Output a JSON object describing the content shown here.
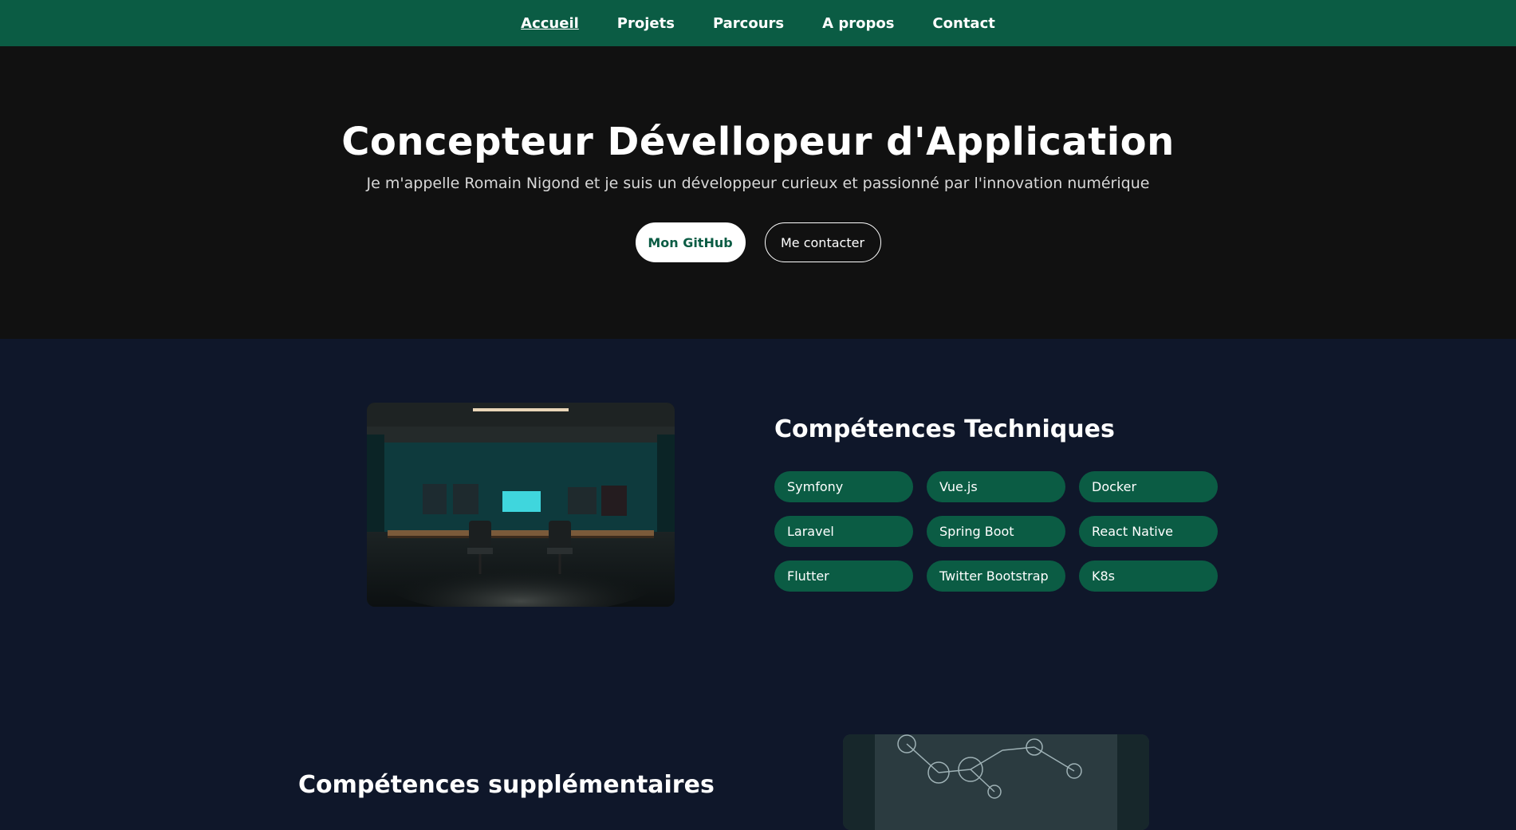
{
  "nav": {
    "items": [
      {
        "label": "Accueil",
        "active": true
      },
      {
        "label": "Projets",
        "active": false
      },
      {
        "label": "Parcours",
        "active": false
      },
      {
        "label": "A propos",
        "active": false
      },
      {
        "label": "Contact",
        "active": false
      }
    ]
  },
  "hero": {
    "title": "Concepteur Dévellopeur d'Application",
    "subtitle": "Je m'appelle Romain Nigond et je suis un développeur curieux et passionné par l'innovation numérique",
    "primary_button": "Mon GitHub",
    "secondary_button": "Me contacter"
  },
  "skills": {
    "title": "Compétences Techniques",
    "items": [
      "Symfony",
      "Vue.js",
      "Docker",
      "Laravel",
      "Spring Boot",
      "React Native",
      "Flutter",
      "Twitter Bootstrap",
      "K8s"
    ]
  },
  "extra": {
    "title": "Compétences supplémentaires"
  },
  "colors": {
    "accent": "#0b5c44",
    "hero_bg": "#111111",
    "page_bg": "#0f172a"
  }
}
